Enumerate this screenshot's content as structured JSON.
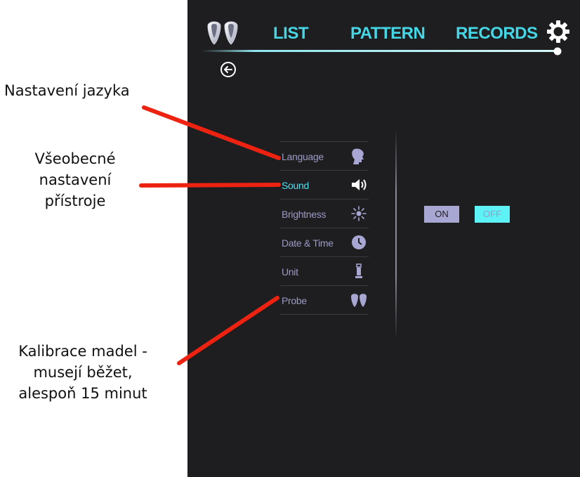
{
  "annotations": {
    "language_note": "Nastavení jazyka",
    "general_note": [
      "Všeobecné",
      "nastavení",
      "přístroje"
    ],
    "calibration_note": [
      "Kalibrace madel -",
      "musejí běžet,",
      "alespoň 15 minut"
    ],
    "arrow_color": "#ee2211"
  },
  "nav": {
    "tabs": [
      "LIST",
      "PATTERN",
      "RECORDS"
    ],
    "accent": "#45d6e6"
  },
  "settings_menu": {
    "items": [
      {
        "label": "Language",
        "icon": "head-icon"
      },
      {
        "label": "Sound",
        "icon": "speaker-icon",
        "active": true
      },
      {
        "label": "Brightness",
        "icon": "sun-icon"
      },
      {
        "label": "Date & Time",
        "icon": "clock-icon"
      },
      {
        "label": "Unit",
        "icon": "unit-icon"
      },
      {
        "label": "Probe",
        "icon": "probe-icon"
      }
    ]
  },
  "sound_toggle": {
    "on_label": "ON",
    "off_label": "OFF",
    "selected": "OFF"
  }
}
